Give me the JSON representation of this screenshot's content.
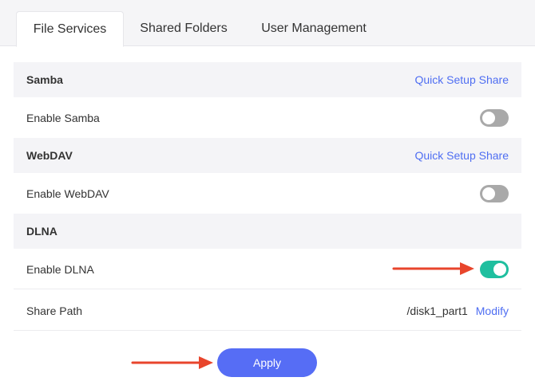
{
  "tabs": [
    {
      "label": "File Services",
      "active": true
    },
    {
      "label": "Shared Folders",
      "active": false
    },
    {
      "label": "User Management",
      "active": false
    }
  ],
  "samba": {
    "title": "Samba",
    "quick_setup": "Quick Setup Share",
    "enable_label": "Enable Samba",
    "enabled": false
  },
  "webdav": {
    "title": "WebDAV",
    "quick_setup": "Quick Setup Share",
    "enable_label": "Enable WebDAV",
    "enabled": false
  },
  "dlna": {
    "title": "DLNA",
    "enable_label": "Enable DLNA",
    "enabled": true,
    "share_path_label": "Share Path",
    "share_path_value": "/disk1_part1",
    "modify_label": "Modify"
  },
  "apply_label": "Apply",
  "colors": {
    "accent": "#566df5",
    "link": "#4f6ef2",
    "toggle_on": "#1fbf9f",
    "toggle_off": "#a9a9a9",
    "arrow": "#e8452c"
  }
}
